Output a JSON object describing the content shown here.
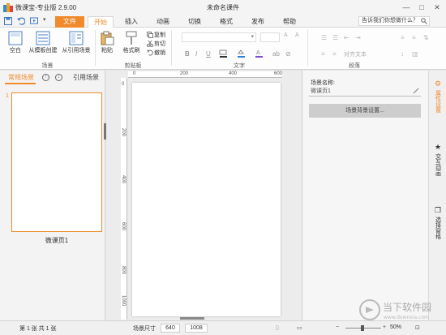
{
  "app": {
    "title": "微课宝-专业版 2.9.00",
    "document_title": "未命名课件"
  },
  "window_controls": [
    "—",
    "□",
    "✕"
  ],
  "tabs": [
    {
      "label": "文件",
      "state": "file"
    },
    {
      "label": "开始",
      "state": "active"
    },
    {
      "label": "插入"
    },
    {
      "label": "动画"
    },
    {
      "label": "切换"
    },
    {
      "label": "格式"
    },
    {
      "label": "发布"
    },
    {
      "label": "帮助"
    }
  ],
  "search": {
    "placeholder": "告诉我们你想做什么？"
  },
  "ribbon": {
    "scene_group": {
      "label": "场景",
      "buttons": [
        "空白",
        "从模板创建",
        "从引用场景"
      ]
    },
    "clipboard_group": {
      "label": "剪贴板",
      "paste": "粘贴",
      "format_painter": "格式刷",
      "copy": "复制",
      "cut": "剪切",
      "undo": "撤销"
    },
    "text_group": {
      "label": "文字",
      "bold": "B",
      "italic": "I",
      "underline": "U"
    },
    "paragraph_group": {
      "label": "段落",
      "align_text": "对齐文本"
    }
  },
  "left_panel": {
    "tab_scenes": "常规场景",
    "tab_refs": "引用场景",
    "up_icon": "↑",
    "down_icon": "↓",
    "slide_number": "1",
    "slide_caption": "微课页1"
  },
  "rulers": {
    "h": [
      "0",
      "200",
      "400",
      "600"
    ],
    "v": [
      "0",
      "200",
      "400",
      "600",
      "800",
      "1000"
    ]
  },
  "properties": {
    "scene_name_label": "场景名称:",
    "scene_name_value": "微课页1",
    "background_button": "场景背景设置..."
  },
  "side_tabs": [
    {
      "label": "属性设置",
      "icon": "gear-icon",
      "active": true
    },
    {
      "label": "交互动画",
      "icon": "star-icon"
    },
    {
      "label": "选择窗格",
      "icon": "layers-icon"
    }
  ],
  "status": {
    "page_info": "第 1 张  共 1 张",
    "scene_size_label": "场景尺寸",
    "width": "640",
    "height": "1008",
    "zoom": "50%"
  },
  "watermark": {
    "text": "当下软件园",
    "url_text": "www.downxia.com"
  },
  "colors": {
    "accent": "#f08a2a"
  }
}
